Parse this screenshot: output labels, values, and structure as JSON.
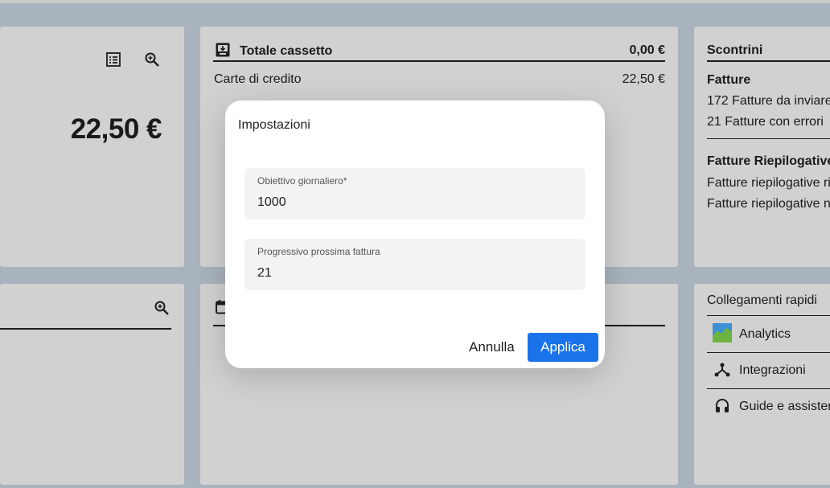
{
  "top_left_card": {
    "list_icon": "list-icon",
    "zoom_icon": "zoom-in-icon",
    "amount": "22,50 €"
  },
  "drawer_card": {
    "icon": "cash-drawer-icon",
    "title": "Totale cassetto",
    "total": "0,00 €",
    "rows": [
      {
        "label": "Carte di credito",
        "value": "22,50 €"
      }
    ]
  },
  "receipts_card": {
    "title": "Scontrini",
    "sections": [
      {
        "heading": "Fatture",
        "items": [
          "172 Fatture da inviare",
          "21 Fatture con errori"
        ]
      },
      {
        "heading": "Fatture Riepilogative",
        "items": [
          "Fatture riepilogative ri",
          "Fatture riepilogative n"
        ]
      }
    ]
  },
  "bottom_left_card": {
    "zoom_icon": "zoom-in-icon"
  },
  "bottom_mid_card": {
    "calendar_icon": "calendar-icon"
  },
  "quick_links": {
    "title": "Collegamenti rapidi",
    "items": [
      {
        "icon": "analytics-icon",
        "label": "Analytics"
      },
      {
        "icon": "integrations-icon",
        "label": "Integrazioni"
      },
      {
        "icon": "headset-icon",
        "label": "Guide e assistenza"
      }
    ]
  },
  "dialog": {
    "title": "Impostazioni",
    "fields": [
      {
        "label": "Obiettivo giornaliero*",
        "value": "1000"
      },
      {
        "label": "Progressivo prossima fattura",
        "value": "21"
      }
    ],
    "cancel_label": "Annulla",
    "apply_label": "Applica"
  },
  "colors": {
    "backdrop": "#a9b3bd",
    "card": "#d1d1d1",
    "accent": "#1a73e8"
  }
}
